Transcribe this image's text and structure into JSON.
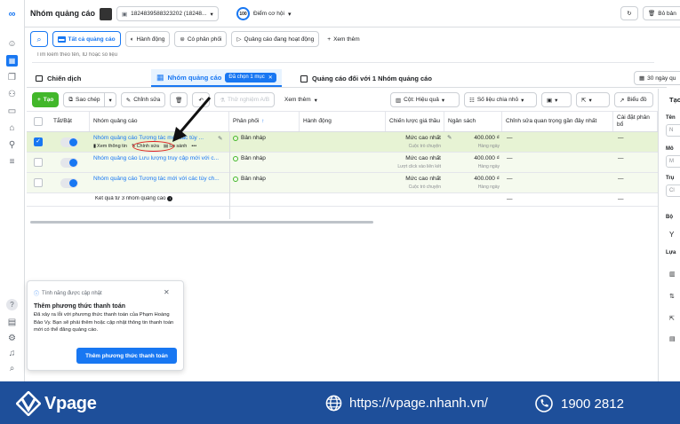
{
  "topbar": {
    "title": "Nhóm quảng cáo",
    "account_id": "1824839588323202 (18248...",
    "score_badge": "100",
    "score_label": "Điểm cơ hội",
    "right_button": "Bỏ bản"
  },
  "filterbar": {
    "all_ads": "Tất cả quảng cáo",
    "action": "Hành động",
    "has_delivery": "Có phân phối",
    "active_ads": "Quảng cáo đang hoạt động",
    "see_more": "Xem thêm"
  },
  "search": {
    "placeholder": "Tìm kiếm theo tên, ID hoặc số liệu"
  },
  "tabs": {
    "campaign": "Chiến dịch",
    "adsets": "Nhóm quảng cáo",
    "selected_chip": "Đã chọn 1 mục",
    "ads": "Quảng cáo đối với 1 Nhóm quảng cáo",
    "date_range": "30 ngày qu"
  },
  "toolbar": {
    "create": "Tạo",
    "duplicate": "Sao chép",
    "edit": "Chỉnh sửa",
    "ab_test": "Thử nghiệm A/B",
    "view_more": "Xem thêm",
    "columns": "Cột: Hiệu quả",
    "breakdown": "Số liệu chia nhỏ",
    "charts": "Biểu đồ"
  },
  "columns": [
    "Tắt/Bật",
    "Nhóm quảng cáo",
    "Phân phối",
    "Hành động",
    "Chiến lược giá thầu",
    "Ngân sách",
    "Chỉnh sửa quan trọng gần đây nhất",
    "Cài đặt phân bổ"
  ],
  "rows": [
    {
      "name": "Nhóm quảng cáo Tương tác mới các tùy ...",
      "delivery": "Bản nháp",
      "bid": "Mức cao nhất",
      "bid_sub": "Cuộc trò chuyện",
      "budget": "400.000 ₫",
      "budget_sub": "Hàng ngày",
      "recent": "—",
      "alloc": "—",
      "selected": true
    },
    {
      "name": "Nhóm quảng cáo Lưu lượng truy cập mới với c...",
      "delivery": "Bản nháp",
      "bid": "Mức cao nhất",
      "bid_sub": "Lượt click vào liên kết",
      "budget": "400.000 ₫",
      "budget_sub": "Hàng ngày",
      "recent": "—",
      "alloc": "—",
      "selected": false
    },
    {
      "name": "Nhóm quảng cáo Tương tác mới với các tùy ch...",
      "delivery": "Bản nháp",
      "bid": "Mức cao nhất",
      "bid_sub": "Cuộc trò chuyện",
      "budget": "400.000 ₫",
      "budget_sub": "Hàng ngày",
      "recent": "—",
      "alloc": "—",
      "selected": false
    }
  ],
  "row_actions": {
    "view": "Xem thông tin",
    "edit": "Chỉnh sửa",
    "compare": "So sánh",
    "more": "•••"
  },
  "results_label": "Kết quả từ 3 nhóm quảng cáo",
  "result_dashes": [
    "—",
    "—"
  ],
  "right_panel": {
    "title": "Tạo",
    "labels": [
      "Tên",
      "Mô",
      "Trụ",
      "Bộ",
      "Lựa"
    ],
    "inputs": [
      "N",
      "M",
      "Cl"
    ]
  },
  "notification": {
    "header": "Tính năng được cập nhật",
    "title": "Thêm phương thức thanh toán",
    "body": "Đã xảy ra lỗi với phương thức thanh toán của Phạm Hoàng Bảo Vy. Bạn sẽ phải thêm hoặc cập nhật thông tin thanh toán mới có thể đăng quảng cáo.",
    "button": "Thêm phương thức thanh toán"
  },
  "footer": {
    "brand": "Vpage",
    "url": "https://vpage.nhanh.vn/",
    "phone": "1900 2812"
  },
  "colors": {
    "accent": "#1877f2",
    "selected_row": "#e7f3d4",
    "footer_bg": "#1e4f9a"
  }
}
